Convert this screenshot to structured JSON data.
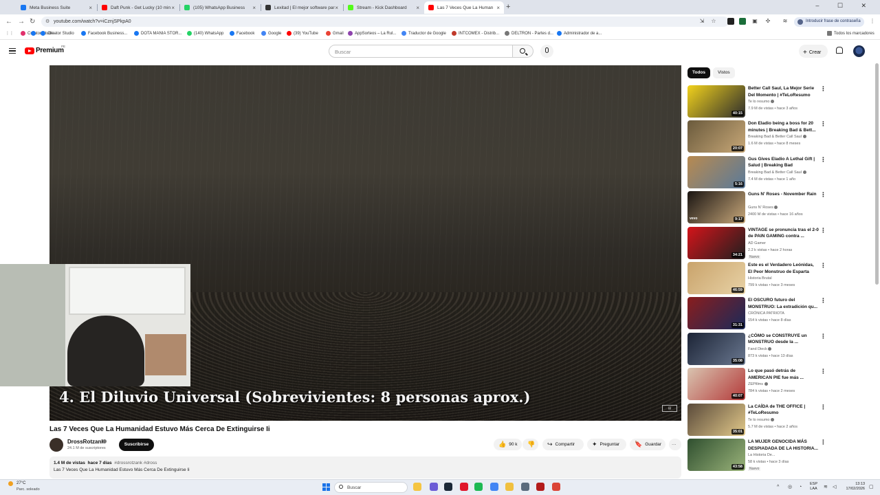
{
  "browser": {
    "tabs": [
      {
        "title": "Meta Business Suite",
        "color": "#1877f2"
      },
      {
        "title": "Daft Punk - Get Lucky (10 min",
        "color": "#ff0000"
      },
      {
        "title": "(105) WhatsApp Business",
        "color": "#25d366"
      },
      {
        "title": "Lexitad | El mejor software par",
        "color": "#333333"
      },
      {
        "title": "Stream - Kick Dashboard",
        "color": "#53fc18"
      },
      {
        "title": "Las 7 Veces Que La Human",
        "color": "#ff0000",
        "active": true
      }
    ],
    "new_tab": "+",
    "url": "youtube.com/watch?v=iCznjSPkpA0",
    "password_chip": "Introducir frase de contraseña",
    "bookmarks": [
      {
        "label": "Creator Studio",
        "color": "#e1306c"
      },
      {
        "label": "",
        "color": "#1877f2"
      },
      {
        "label": "Facebook Business...",
        "color": "#1877f2"
      },
      {
        "label": "DOTA MANIA STOR...",
        "color": "#1877f2"
      },
      {
        "label": "(140) WhatsApp",
        "color": "#25d366"
      },
      {
        "label": "Facebook",
        "color": "#1877f2"
      },
      {
        "label": "Google",
        "color": "#4285f4"
      },
      {
        "label": "(39) YouTube",
        "color": "#ff0000"
      },
      {
        "label": "Gmail",
        "color": "#ea4335"
      },
      {
        "label": "AppSorteos – La Rul...",
        "color": "#8e44ad"
      },
      {
        "label": "Traductor de Google",
        "color": "#4285f4"
      },
      {
        "label": "INTCOMEX - Distrib...",
        "color": "#c0392b"
      },
      {
        "label": "DELTRON - Partes d...",
        "color": "#777777"
      },
      {
        "label": "Administrador de a...",
        "color": "#1877f2"
      }
    ],
    "all_bookmarks": "Todos los marcadores"
  },
  "youtube": {
    "brand": "Premium",
    "country": "PE",
    "search_placeholder": "Buscar",
    "create_label": "Crear",
    "video": {
      "caption": "4. El Diluvio Universal (Sobrevivientes: 8 personas aprox.)",
      "title": "Las 7 Veces Que La Humanidad Estuvo Más Cerca De Extinguirse Ii",
      "channel": "DrossRotzank",
      "subscribers": "24.1 M de suscriptores",
      "subscribe_label": "Suscribirse",
      "likes": "90 k",
      "share_label": "Compartir",
      "ask_label": "Preguntar",
      "save_label": "Guardar",
      "more_label": "···",
      "views": "1.4 M de vistas",
      "age": "hace 7 días",
      "tags": "#drossrotzank #dross",
      "description": "Las 7 Veces Que La Humanidad Estuvo Más Cerca De Extinguirse Ii"
    },
    "filter_chips": [
      "Todos",
      "Vistos"
    ],
    "recommendations": [
      {
        "title": "Better Call Saul, La Mejor Serie Del Momento | #TeLoResumo",
        "channel": "Te lo resumo",
        "verified": true,
        "meta": "7.9 M de vistas • hace 3 años",
        "duration": "40:15",
        "c1": "#f2d21c",
        "c2": "#2d2d2d"
      },
      {
        "title": "Don Eladio being a boss for 20 minutes | Breaking Bad & Bett...",
        "channel": "Breaking Bad & Better Call Saul",
        "verified": true,
        "meta": "1.6 M de vistas • hace 8 meses",
        "duration": "20:07",
        "c1": "#6a5a3c",
        "c2": "#c8a878"
      },
      {
        "title": "Gus Gives Eladio A Lethal Gift | Salud | Breaking Bad",
        "channel": "Breaking Bad & Better Call Saul",
        "verified": true,
        "meta": "7.4 M de vistas • hace 1 año",
        "duration": "5:16",
        "c1": "#b88a50",
        "c2": "#5a7a9a"
      },
      {
        "title": "Guns N' Roses - November Rain",
        "channel": "Guns N' Roses",
        "verified": true,
        "meta": "2400 M de vistas • hace 16 años",
        "duration": "9:17",
        "c1": "#1a1512",
        "c2": "#c7a77a",
        "badge_logo": "vevo"
      },
      {
        "title": "VINTAGE se pronuncia tras el 2-0 de PAIN GAMING contra ...",
        "channel": "AD Gamer",
        "verified": false,
        "meta": "2.2 k vistas • hace 2 horas",
        "duration": "34:21",
        "c1": "#d4141a",
        "c2": "#1f1f1f",
        "badge": "Nuevo"
      },
      {
        "title": "Este es el Verdadero Leónidas, El Peor Monstruo de Esparta",
        "channel": "Historia Brutal",
        "verified": false,
        "meta": "799 k vistas • hace 3 meses",
        "duration": "46:59",
        "c1": "#c9a36b",
        "c2": "#e8d2a6"
      },
      {
        "title": "El OSCURO futuro del MONSTRUO: La extradición qu...",
        "channel": "CRÓNICA PATRIOTA",
        "verified": false,
        "meta": "154 k vistas • hace 8 días",
        "duration": "31:31",
        "c1": "#8a1d1d",
        "c2": "#1a2a5a"
      },
      {
        "title": "¿CÓMO se CONSTRUYE un MONSTRUO desde la ...",
        "channel": "Fand Dieck",
        "verified": true,
        "meta": "873 k vistas • hace 13 días",
        "duration": "35:08",
        "c1": "#1c2436",
        "c2": "#6a7890"
      },
      {
        "title": "Lo que pasó detrás de AMERICAN PIE fue más ...",
        "channel": "ZEPfilms",
        "verified": true,
        "meta": "784 k vistas • hace 2 meses",
        "duration": "40:07",
        "c1": "#d9c4b0",
        "c2": "#b43a3a"
      },
      {
        "title": "La CAÍDA de THE OFFICE | #TeLoResumo",
        "channel": "Te lo resumo",
        "verified": true,
        "meta": "5.7 M de vistas • hace 2 años",
        "duration": "35:01",
        "c1": "#5a4a3a",
        "c2": "#e2c98a"
      },
      {
        "title": "LA MUJER GENOCIDA MÁS DESPIADADA DE LA HISTORIA...",
        "channel": "La Historia De...",
        "verified": false,
        "meta": "58 k vistas • hace 3 días",
        "duration": "43:58",
        "c1": "#2f4f2f",
        "c2": "#9ab37a",
        "badge": "Nuevo"
      }
    ]
  },
  "taskbar": {
    "temp": "27°C",
    "weather": "Parc. soleado",
    "search_label": "Buscar",
    "lang_line1": "ESP",
    "lang_line2": "LAA",
    "time": "13:13",
    "date": "17/02/2026",
    "apps": [
      {
        "name": "file-explorer-icon",
        "color": "#f5c542"
      },
      {
        "name": "copilot-icon",
        "color": "#6b5cd6"
      },
      {
        "name": "steam-icon",
        "color": "#1b2838"
      },
      {
        "name": "opera-icon",
        "color": "#e0162b"
      },
      {
        "name": "spotify-icon",
        "color": "#1db954"
      },
      {
        "name": "chrome-icon",
        "color": "#4285f4"
      },
      {
        "name": "folder-icon",
        "color": "#f0c040"
      },
      {
        "name": "app-icon",
        "color": "#5a6b7d"
      },
      {
        "name": "filezilla-icon",
        "color": "#b31b1b"
      },
      {
        "name": "chrome-alt-icon",
        "color": "#db4437"
      }
    ]
  }
}
